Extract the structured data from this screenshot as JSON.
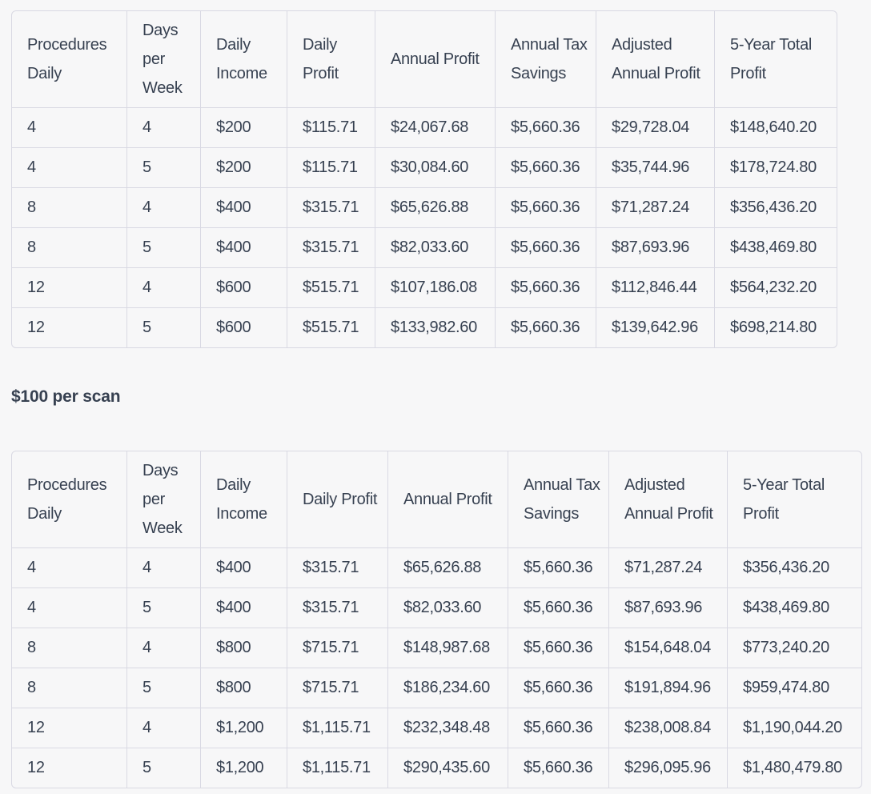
{
  "table1": {
    "headers": [
      "Procedures Daily",
      "Days per Week",
      "Daily Income",
      "Daily Profit",
      "Annual Profit",
      "Annual Tax Savings",
      "Adjusted Annual Profit",
      "5-Year Total Profit"
    ],
    "rows": [
      [
        "4",
        "4",
        "$200",
        "$115.71",
        "$24,067.68",
        "$5,660.36",
        "$29,728.04",
        "$148,640.20"
      ],
      [
        "4",
        "5",
        "$200",
        "$115.71",
        "$30,084.60",
        "$5,660.36",
        "$35,744.96",
        "$178,724.80"
      ],
      [
        "8",
        "4",
        "$400",
        "$315.71",
        "$65,626.88",
        "$5,660.36",
        "$71,287.24",
        "$356,436.20"
      ],
      [
        "8",
        "5",
        "$400",
        "$315.71",
        "$82,033.60",
        "$5,660.36",
        "$87,693.96",
        "$438,469.80"
      ],
      [
        "12",
        "4",
        "$600",
        "$515.71",
        "$107,186.08",
        "$5,660.36",
        "$112,846.44",
        "$564,232.20"
      ],
      [
        "12",
        "5",
        "$600",
        "$515.71",
        "$133,982.60",
        "$5,660.36",
        "$139,642.96",
        "$698,214.80"
      ]
    ]
  },
  "caption": "$100 per scan",
  "table2": {
    "headers": [
      "Procedures Daily",
      "Days per Week",
      "Daily Income",
      "Daily Profit",
      "Annual Profit",
      "Annual Tax Savings",
      "Adjusted Annual Profit",
      "5-Year Total Profit"
    ],
    "rows": [
      [
        "4",
        "4",
        "$400",
        "$315.71",
        "$65,626.88",
        "$5,660.36",
        "$71,287.24",
        "$356,436.20"
      ],
      [
        "4",
        "5",
        "$400",
        "$315.71",
        "$82,033.60",
        "$5,660.36",
        "$87,693.96",
        "$438,469.80"
      ],
      [
        "8",
        "4",
        "$800",
        "$715.71",
        "$148,987.68",
        "$5,660.36",
        "$154,648.04",
        "$773,240.20"
      ],
      [
        "8",
        "5",
        "$800",
        "$715.71",
        "$186,234.60",
        "$5,660.36",
        "$191,894.96",
        "$959,474.80"
      ],
      [
        "12",
        "4",
        "$1,200",
        "$1,115.71",
        "$232,348.48",
        "$5,660.36",
        "$238,008.84",
        "$1,190,044.20"
      ],
      [
        "12",
        "5",
        "$1,200",
        "$1,115.71",
        "$290,435.60",
        "$5,660.36",
        "$296,095.96",
        "$1,480,479.80"
      ]
    ]
  },
  "colors": {
    "background": "#f7f7f8",
    "border": "#d9d9e3",
    "text": "#374151"
  }
}
